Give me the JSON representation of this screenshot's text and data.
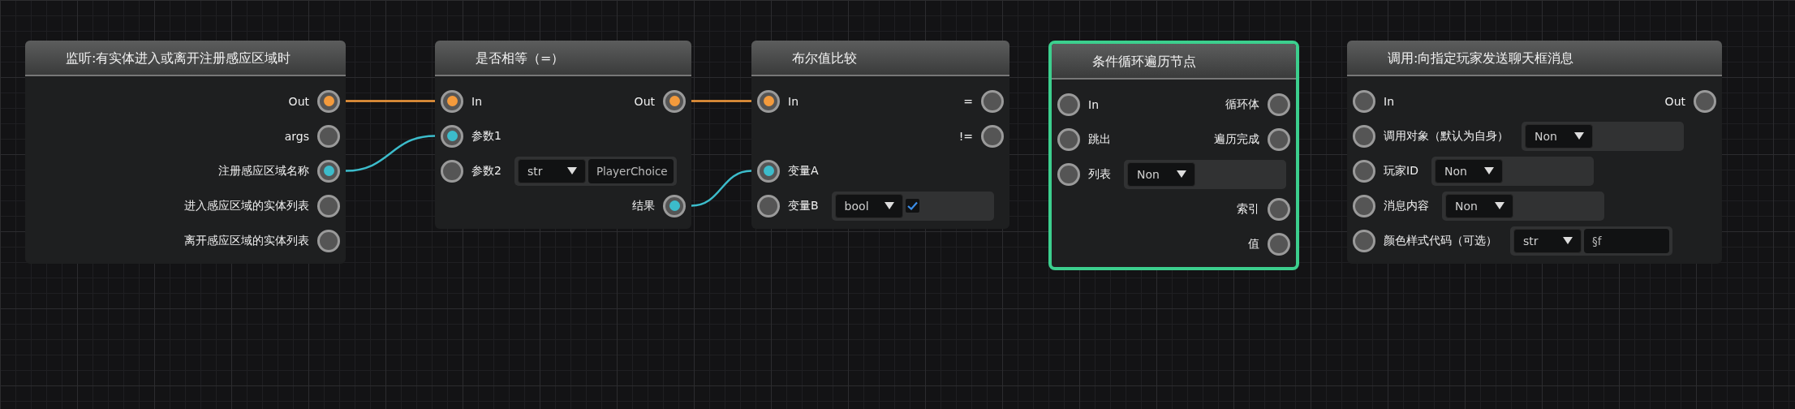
{
  "nodes": [
    {
      "title": "监听:有实体进入或离开注册感应区域时",
      "selected": false,
      "rows": [
        {
          "right": {
            "label": "Out",
            "connected": true,
            "kind": "exec"
          }
        },
        {
          "right": {
            "label": "args",
            "connected": false
          }
        },
        {
          "right": {
            "label": "注册感应区域名称",
            "connected": true,
            "kind": "data"
          }
        },
        {
          "right": {
            "label": "进入感应区域的实体列表",
            "connected": false
          }
        },
        {
          "right": {
            "label": "离开感应区域的实体列表",
            "connected": false
          }
        }
      ]
    },
    {
      "title": "是否相等（=）",
      "selected": false,
      "rows": [
        {
          "left": {
            "label": "In",
            "connected": true,
            "kind": "exec"
          },
          "right": {
            "label": "Out",
            "connected": true,
            "kind": "exec"
          }
        },
        {
          "left": {
            "label": "参数1",
            "connected": true,
            "kind": "data"
          }
        },
        {
          "left": {
            "label": "参数2",
            "connected": false
          },
          "widget": {
            "kind": "select_input",
            "select": "str",
            "value": "PlayerChoice"
          }
        },
        {
          "right": {
            "label": "结果",
            "connected": true,
            "kind": "data"
          }
        }
      ]
    },
    {
      "title": "布尔值比较",
      "selected": false,
      "rows": [
        {
          "left": {
            "label": "In",
            "connected": true,
            "kind": "exec"
          },
          "right": {
            "label": "=",
            "connected": false
          }
        },
        {
          "right": {
            "label": "!=",
            "connected": false
          }
        },
        {
          "left": {
            "label": "变量A",
            "connected": true,
            "kind": "data"
          }
        },
        {
          "left": {
            "label": "变量B",
            "connected": false
          },
          "widget": {
            "kind": "select_check",
            "select": "bool",
            "checked": true
          }
        }
      ]
    },
    {
      "title": "条件循环遍历节点",
      "selected": true,
      "rows": [
        {
          "left": {
            "label": "In",
            "connected": false
          },
          "right": {
            "label": "循环体",
            "connected": false
          }
        },
        {
          "left": {
            "label": "跳出",
            "connected": false
          },
          "right": {
            "label": "遍历完成",
            "connected": false
          }
        },
        {
          "left": {
            "label": "列表",
            "connected": false
          },
          "widget": {
            "kind": "select",
            "select": "Non"
          }
        },
        {
          "right": {
            "label": "索引",
            "connected": false
          }
        },
        {
          "right": {
            "label": "值",
            "connected": false
          }
        }
      ]
    },
    {
      "title": "调用:向指定玩家发送聊天框消息",
      "selected": false,
      "rows": [
        {
          "left": {
            "label": "In",
            "connected": false
          },
          "right": {
            "label": "Out",
            "connected": false
          }
        },
        {
          "left": {
            "label": "调用对象（默认为自身）",
            "connected": false
          },
          "widget": {
            "kind": "select",
            "select": "Non"
          }
        },
        {
          "left": {
            "label": "玩家ID",
            "connected": false
          },
          "widget": {
            "kind": "select",
            "select": "Non"
          }
        },
        {
          "left": {
            "label": "消息内容",
            "connected": false
          },
          "widget": {
            "kind": "select",
            "select": "Non"
          }
        },
        {
          "left": {
            "label": "颜色样式代码（可选）",
            "connected": false
          },
          "widget": {
            "kind": "select_input",
            "select": "str",
            "value": "§f"
          }
        }
      ]
    }
  ]
}
